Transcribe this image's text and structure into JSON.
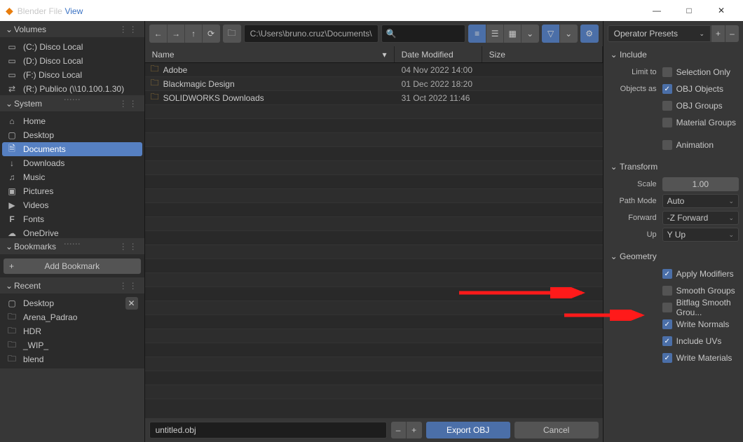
{
  "window": {
    "title_app": "Blender File",
    "title_view": "View",
    "min": "—",
    "max": "□",
    "close": "✕"
  },
  "sidebar": {
    "volumes": {
      "title": "Volumes",
      "items": [
        {
          "icon": "drive",
          "label": "(C:) Disco Local"
        },
        {
          "icon": "drive",
          "label": "(D:) Disco Local"
        },
        {
          "icon": "drive",
          "label": "(F:) Disco Local"
        },
        {
          "icon": "netdrive",
          "label": "(R:) Publico (\\\\10.100.1.30)"
        }
      ]
    },
    "system": {
      "title": "System",
      "items": [
        {
          "icon": "home",
          "label": "Home"
        },
        {
          "icon": "desktop",
          "label": "Desktop"
        },
        {
          "icon": "documents",
          "label": "Documents",
          "selected": true
        },
        {
          "icon": "download",
          "label": "Downloads"
        },
        {
          "icon": "music",
          "label": "Music"
        },
        {
          "icon": "pictures",
          "label": "Pictures"
        },
        {
          "icon": "videos",
          "label": "Videos"
        },
        {
          "icon": "fonts",
          "label": "Fonts"
        },
        {
          "icon": "cloud",
          "label": "OneDrive"
        }
      ]
    },
    "bookmarks": {
      "title": "Bookmarks",
      "add_label": "Add Bookmark",
      "plus": "+"
    },
    "recent": {
      "title": "Recent",
      "items": [
        {
          "icon": "desktop",
          "label": "Desktop",
          "close": true
        },
        {
          "icon": "folder",
          "label": "Arena_Padrao"
        },
        {
          "icon": "folder",
          "label": "HDR"
        },
        {
          "icon": "folder",
          "label": "_WIP_"
        },
        {
          "icon": "folder",
          "label": "blend"
        }
      ]
    }
  },
  "toolbar": {
    "path": "C:\\Users\\bruno.cruz\\Documents\\",
    "back": "←",
    "fwd": "→",
    "up": "↑",
    "refresh": "⟳",
    "newdir": "📁",
    "search": "🔍",
    "filter": "▽",
    "gear": "⚙"
  },
  "columns": {
    "name": "Name",
    "date": "Date Modified",
    "size": "Size",
    "sort": "▾"
  },
  "files": [
    {
      "name": "Adobe",
      "date": "04 Nov 2022 14:00"
    },
    {
      "name": "Blackmagic Design",
      "date": "01 Dec 2022 18:20"
    },
    {
      "name": "SOLIDWORKS Downloads",
      "date": "31 Oct 2022 11:46"
    }
  ],
  "bottom": {
    "filename": "untitled.obj",
    "minus": "–",
    "plus": "+",
    "export": "Export OBJ",
    "cancel": "Cancel"
  },
  "right": {
    "presets": "Operator Presets",
    "plus": "+",
    "minus": "–",
    "include": {
      "title": "Include",
      "limit_to": "Limit to",
      "selection_only": "Selection Only",
      "objects_as": "Objects as",
      "obj_objects": "OBJ Objects",
      "obj_groups": "OBJ Groups",
      "mat_groups": "Material Groups",
      "animation": "Animation"
    },
    "transform": {
      "title": "Transform",
      "scale": "Scale",
      "scale_val": "1.00",
      "path_mode": "Path Mode",
      "path_mode_val": "Auto",
      "forward": "Forward",
      "forward_val": "-Z Forward",
      "up": "Up",
      "up_val": "Y Up"
    },
    "geometry": {
      "title": "Geometry",
      "apply_mod": "Apply Modifiers",
      "smooth": "Smooth Groups",
      "bitflag": "Bitflag Smooth Grou...",
      "normals": "Write Normals",
      "uvs": "Include UVs",
      "materials": "Write Materials"
    }
  }
}
